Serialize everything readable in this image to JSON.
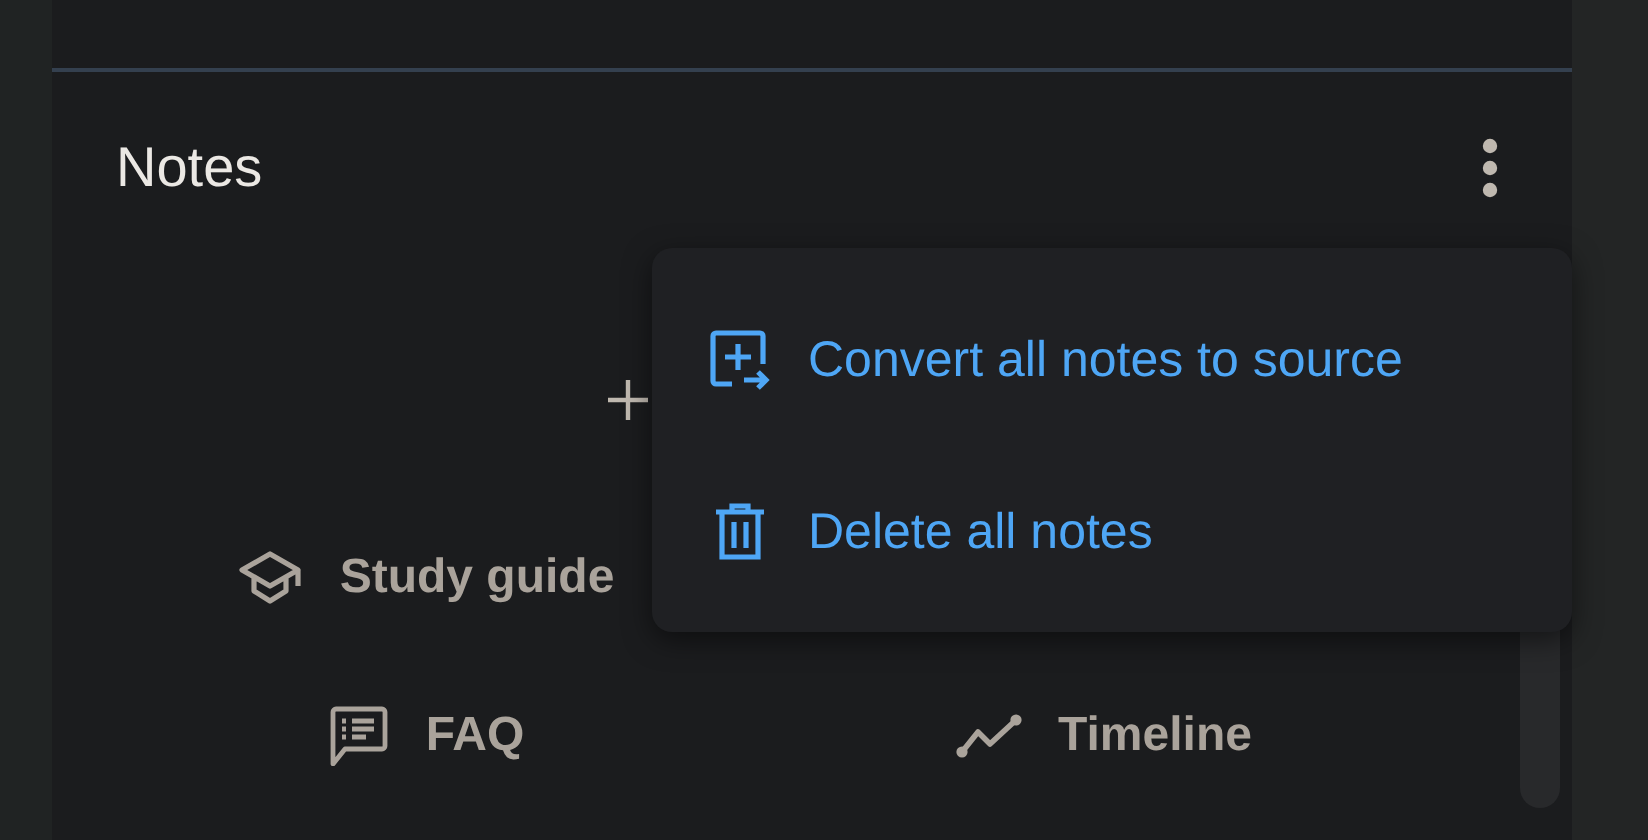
{
  "panel": {
    "title": "Notes"
  },
  "menu": {
    "items": [
      {
        "kind": "convert",
        "label": "Convert all notes to source"
      },
      {
        "kind": "delete",
        "label": "Delete all notes"
      }
    ]
  },
  "suggestions": [
    {
      "kind": "study",
      "label": "Study guide"
    },
    {
      "kind": "faq",
      "label": "FAQ"
    },
    {
      "kind": "timeline",
      "label": "Timeline"
    }
  ]
}
